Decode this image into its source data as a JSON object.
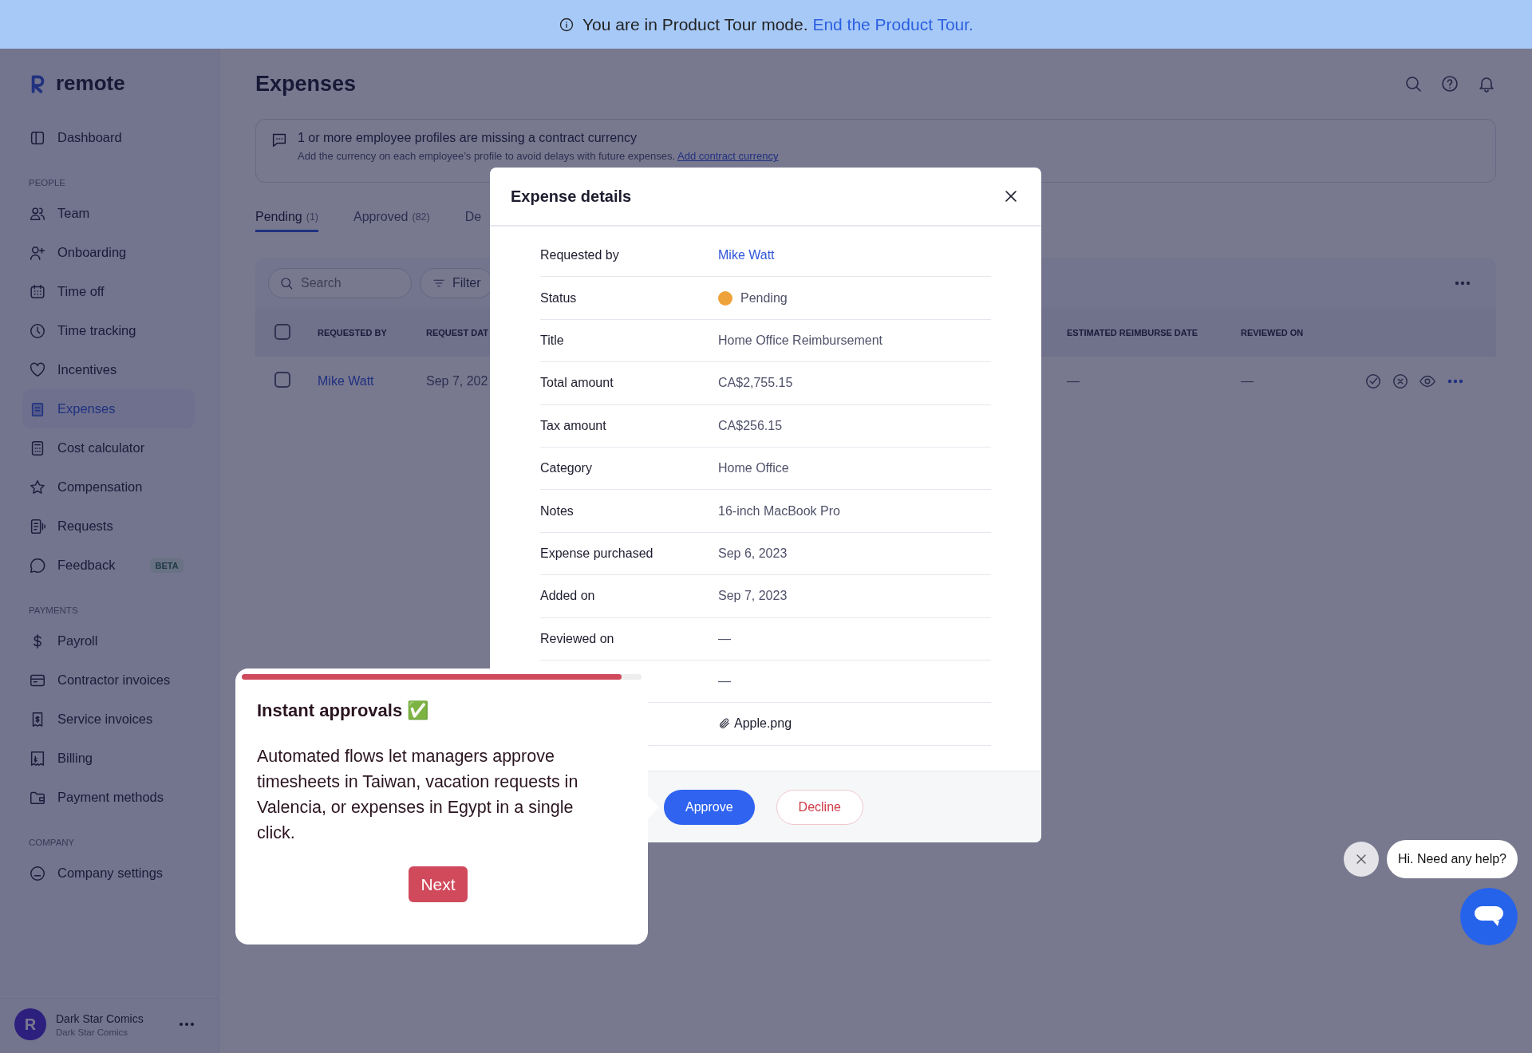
{
  "tour_banner": {
    "text": "You are in Product Tour mode.",
    "link": "End the Product Tour."
  },
  "sidebar": {
    "brand": "remote",
    "sections": [
      {
        "items": [
          {
            "label": "Dashboard",
            "selected": false
          }
        ]
      },
      {
        "heading": "PEOPLE",
        "items": [
          {
            "label": "Team",
            "selected": false
          },
          {
            "label": "Onboarding",
            "selected": false
          },
          {
            "label": "Time off",
            "selected": false
          },
          {
            "label": "Time tracking",
            "selected": false
          },
          {
            "label": "Incentives",
            "selected": false
          },
          {
            "label": "Expenses",
            "selected": true
          },
          {
            "label": "Cost calculator",
            "selected": false
          },
          {
            "label": "Compensation",
            "selected": false
          },
          {
            "label": "Requests",
            "selected": false
          },
          {
            "label": "Feedback",
            "selected": false,
            "badge": "BETA"
          }
        ]
      },
      {
        "heading": "PAYMENTS",
        "items": [
          {
            "label": "Payroll",
            "selected": false
          },
          {
            "label": "Contractor invoices",
            "selected": false
          },
          {
            "label": "Service invoices",
            "selected": false
          },
          {
            "label": "Billing",
            "selected": false
          },
          {
            "label": "Payment methods",
            "selected": false
          }
        ]
      },
      {
        "heading": "COMPANY",
        "items": [
          {
            "label": "Company settings",
            "selected": false
          }
        ]
      }
    ],
    "account": {
      "avatar": "R",
      "name": "Dark Star Comics",
      "subtitle": "Dark Star Comics"
    }
  },
  "page": {
    "title": "Expenses",
    "notice": {
      "title": "1 or more employee profiles are missing a contract currency",
      "text": "Add the currency on each employee’s profile to avoid delays with future expenses.",
      "link": "Add contract currency"
    },
    "tabs": [
      {
        "label": "Pending",
        "count": "(1)",
        "selected": true
      },
      {
        "label": "Approved",
        "count": "(82)",
        "selected": false
      },
      {
        "label": "De",
        "selected": false
      }
    ],
    "search": {
      "placeholder": "Search"
    },
    "filter": "Filter",
    "table": {
      "all_checked": false,
      "columns": [
        "REQUESTED BY",
        "REQUEST DAT",
        "ESTIMATED REIMBURSE DATE",
        "REVIEWED ON"
      ],
      "rows": [
        {
          "checked": false,
          "cells": [
            "Mike Watt",
            "Sep 7, 202",
            "—",
            "—"
          ]
        }
      ]
    }
  },
  "modal": {
    "title": "Expense details",
    "fields": [
      {
        "kind": "link",
        "label": "Requested by",
        "value": "Mike Watt"
      },
      {
        "kind": "status",
        "label": "Status",
        "value": "Pending",
        "color": "#f0a23a"
      },
      {
        "kind": "text",
        "label": "Title",
        "value": "Home Office Reimbursement"
      },
      {
        "kind": "text",
        "label": "Total amount",
        "value": "CA$2,755.15"
      },
      {
        "kind": "text",
        "label": "Tax amount",
        "value": "CA$256.15"
      },
      {
        "kind": "text",
        "label": "Category",
        "value": "Home Office"
      },
      {
        "kind": "text",
        "label": "Notes",
        "value": "16-inch MacBook Pro"
      },
      {
        "kind": "text",
        "label": "Expense purchased",
        "value": "Sep 6, 2023"
      },
      {
        "kind": "text",
        "label": "Added on",
        "value": "Sep 7, 2023"
      },
      {
        "kind": "text",
        "label": "Reviewed on",
        "value": "—"
      },
      {
        "kind": "text",
        "value": "—"
      },
      {
        "kind": "file",
        "value": "Apple.png"
      }
    ],
    "buttons": [
      {
        "kind": "primary",
        "label": "Approve"
      },
      {
        "kind": "danger",
        "label": "Decline"
      }
    ]
  },
  "tour_step": {
    "title": "Instant approvals ✅",
    "body": "Automated flows let managers approve timesheets in Taiwan, vacation requests in Valencia, or expenses in Egypt in a single click.",
    "level": 0.95,
    "button": "Next"
  },
  "chat": {
    "greeting": "Hi. Need any help?"
  }
}
